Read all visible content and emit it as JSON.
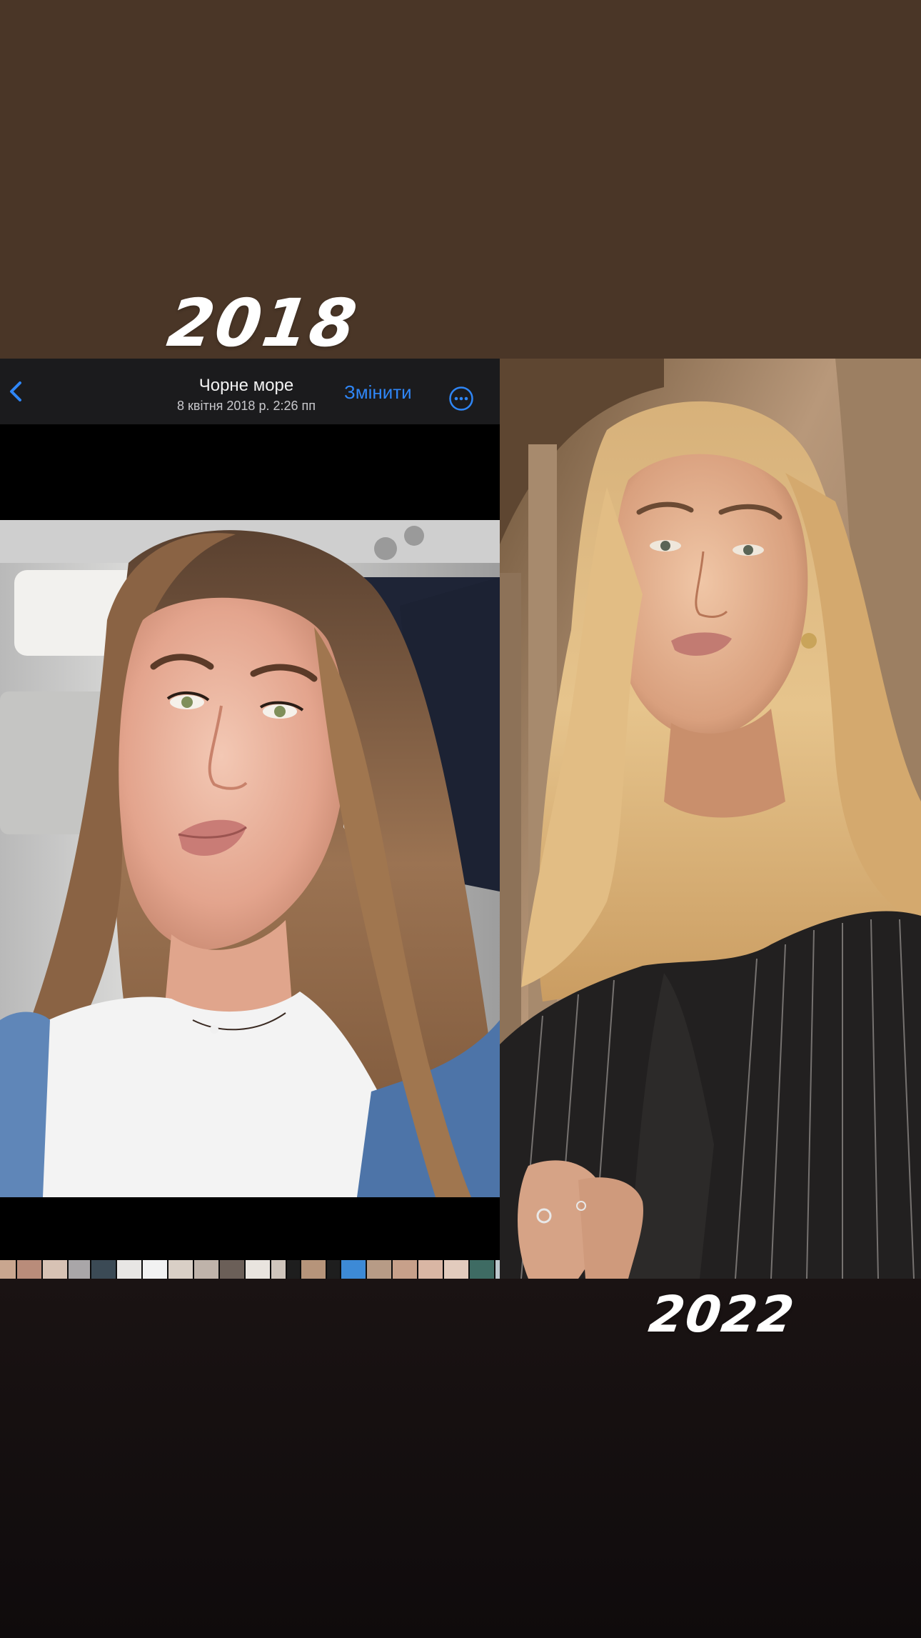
{
  "labels": {
    "year_left": "2018",
    "year_right": "2022"
  },
  "photos_app": {
    "title": "Чорне море",
    "subtitle": "8 квітня 2018 р.  2:26 пп",
    "edit_label": "Змінити",
    "back_icon": "chevron-left-icon",
    "more_icon": "ellipsis-circle-icon",
    "accent_color": "#2f86f6"
  },
  "thumbnail_colors": [
    "#c9a68f",
    "#b98c7a",
    "#d7c2b4",
    "#a9a6a8",
    "#3b4a55",
    "#e8e6e4",
    "#f2f2f2",
    "#d9cfc6",
    "#bfb3aa",
    "#6b5f58",
    "#e9e4df",
    "#cfc5bc",
    "#1e1e1e",
    "#b6947a",
    "#1e1e1e",
    "#3d8ad6",
    "#b79b86",
    "#c7a08a",
    "#d9b6a4",
    "#e2cbbd",
    "#3e6b63",
    "#bcc7cd",
    "#b7c1c6",
    "#a7b4ba",
    "#c8b3a2"
  ]
}
